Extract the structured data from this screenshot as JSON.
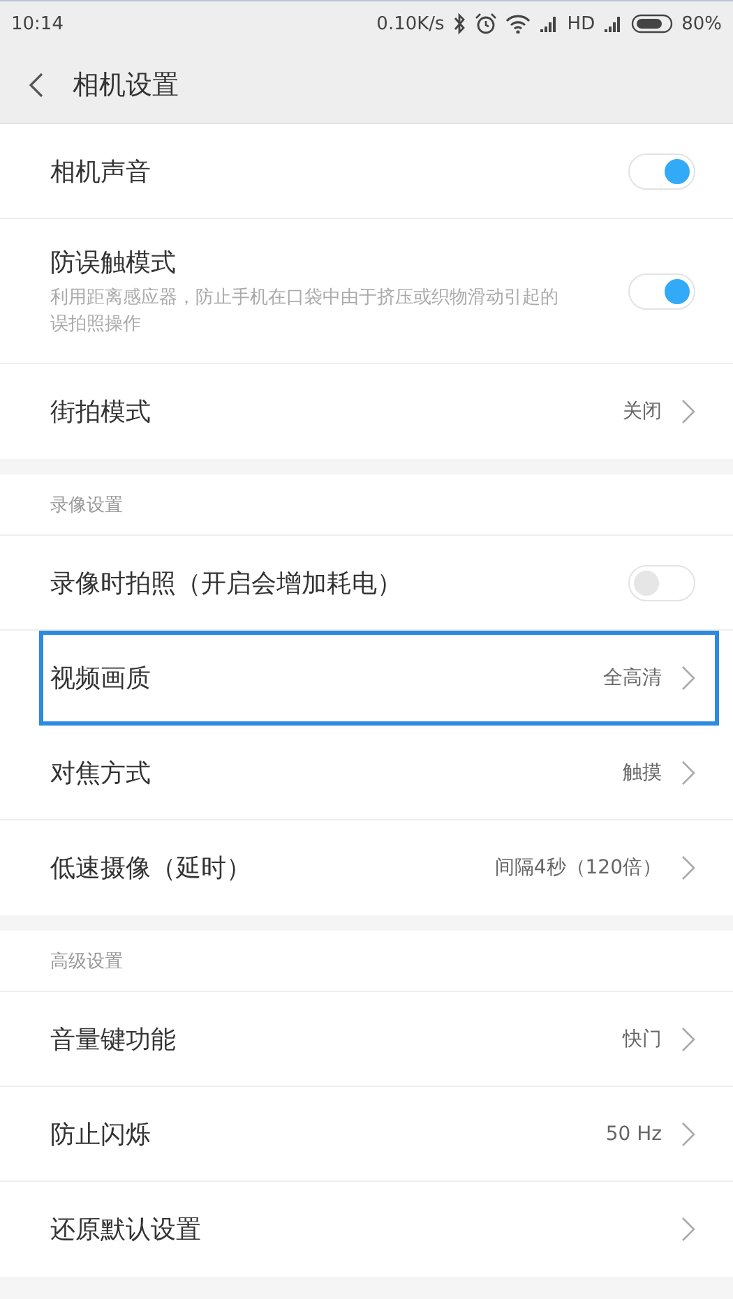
{
  "status_bar": {
    "time": "10:14",
    "speed": "0.10K/s",
    "network": "HD",
    "battery": "80%"
  },
  "header": {
    "title": "相机设置"
  },
  "sections": [
    {
      "items": [
        {
          "kind": "toggle",
          "label": "相机声音",
          "on": true,
          "selected": false
        },
        {
          "kind": "toggle",
          "label": "防误触模式",
          "description": "利用距离感应器，防止手机在口袋中由于挤压或织物滑动引起的误拍照操作",
          "on": true,
          "selected": false
        },
        {
          "kind": "link",
          "label": "街拍模式",
          "value": "关闭",
          "selected": false
        }
      ]
    },
    {
      "title": "录像设置",
      "items": [
        {
          "kind": "toggle",
          "label": "录像时拍照（开启会增加耗电）",
          "on": false,
          "selected": false
        },
        {
          "kind": "link",
          "label": "视频画质",
          "value": "全高清",
          "selected": true
        },
        {
          "kind": "link",
          "label": "对焦方式",
          "value": "触摸",
          "selected": false
        },
        {
          "kind": "link",
          "label": "低速摄像（延时）",
          "value": "间隔4秒（120倍）",
          "selected": false
        }
      ]
    },
    {
      "title": "高级设置",
      "items": [
        {
          "kind": "link",
          "label": "音量键功能",
          "value": "快门",
          "selected": false
        },
        {
          "kind": "link",
          "label": "防止闪烁",
          "value": "50 Hz",
          "selected": false
        },
        {
          "kind": "link",
          "label": "还原默认设置",
          "selected": false
        }
      ]
    }
  ]
}
